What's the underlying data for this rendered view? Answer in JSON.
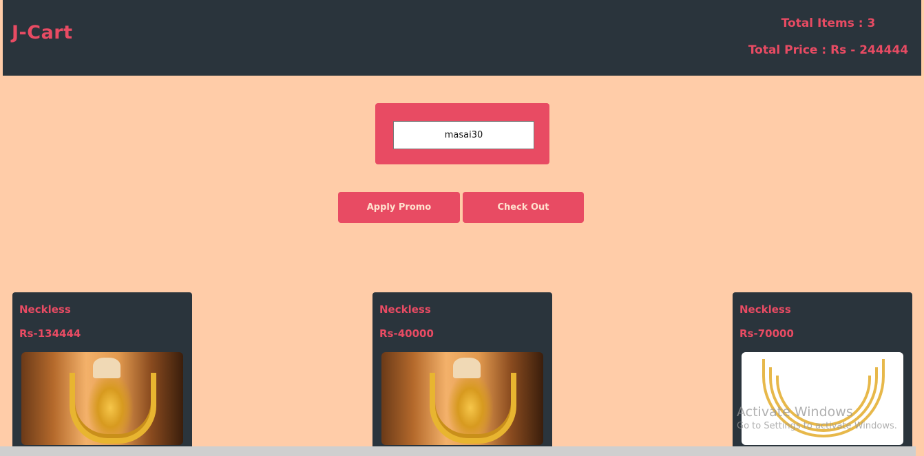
{
  "header": {
    "brand": "J-Cart",
    "total_items": "Total Items : 3",
    "total_price": "Total Price : Rs - 244444"
  },
  "promo": {
    "input_value": "masai30",
    "apply_label": "Apply Promo",
    "checkout_label": "Check Out"
  },
  "products": [
    {
      "name": "Neckless",
      "price": "Rs-134444",
      "image": "gold-necklace-on-bust"
    },
    {
      "name": "Neckless",
      "price": "Rs-40000",
      "image": "gold-necklace-on-bust"
    },
    {
      "name": "Neckless",
      "price": "Rs-70000",
      "image": "gold-layered-necklace-white-bg"
    }
  ],
  "watermark": {
    "line1": "Activate Windows",
    "line2": "Go to Settings to activate Windows."
  },
  "colors": {
    "header_bg": "#2a343c",
    "accent": "#e84b63",
    "page_bg": "#ffcca8"
  }
}
